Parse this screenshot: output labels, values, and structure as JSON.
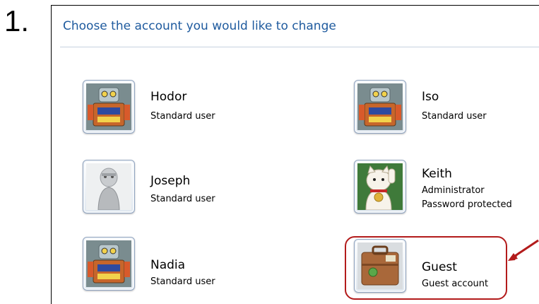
{
  "step": {
    "number": "1."
  },
  "panel": {
    "title": "Choose the account you would like to change"
  },
  "accounts": [
    {
      "name": "Hodor",
      "lines": [
        "Standard user"
      ],
      "avatar": "robot-avatar-icon"
    },
    {
      "name": "Iso",
      "lines": [
        "Standard user"
      ],
      "avatar": "robot-avatar-icon"
    },
    {
      "name": "Joseph",
      "lines": [
        "Standard user"
      ],
      "avatar": "figure-avatar-icon"
    },
    {
      "name": "Keith",
      "lines": [
        "Administrator",
        "Password protected"
      ],
      "avatar": "lucky-cat-avatar-icon"
    },
    {
      "name": "Nadia",
      "lines": [
        "Standard user"
      ],
      "avatar": "robot-avatar-icon"
    },
    {
      "name": "Guest",
      "lines": [
        "Guest account"
      ],
      "avatar": "suitcase-avatar-icon"
    }
  ],
  "annotation": {
    "highlight_color": "#b31b1b",
    "target": "Guest"
  }
}
